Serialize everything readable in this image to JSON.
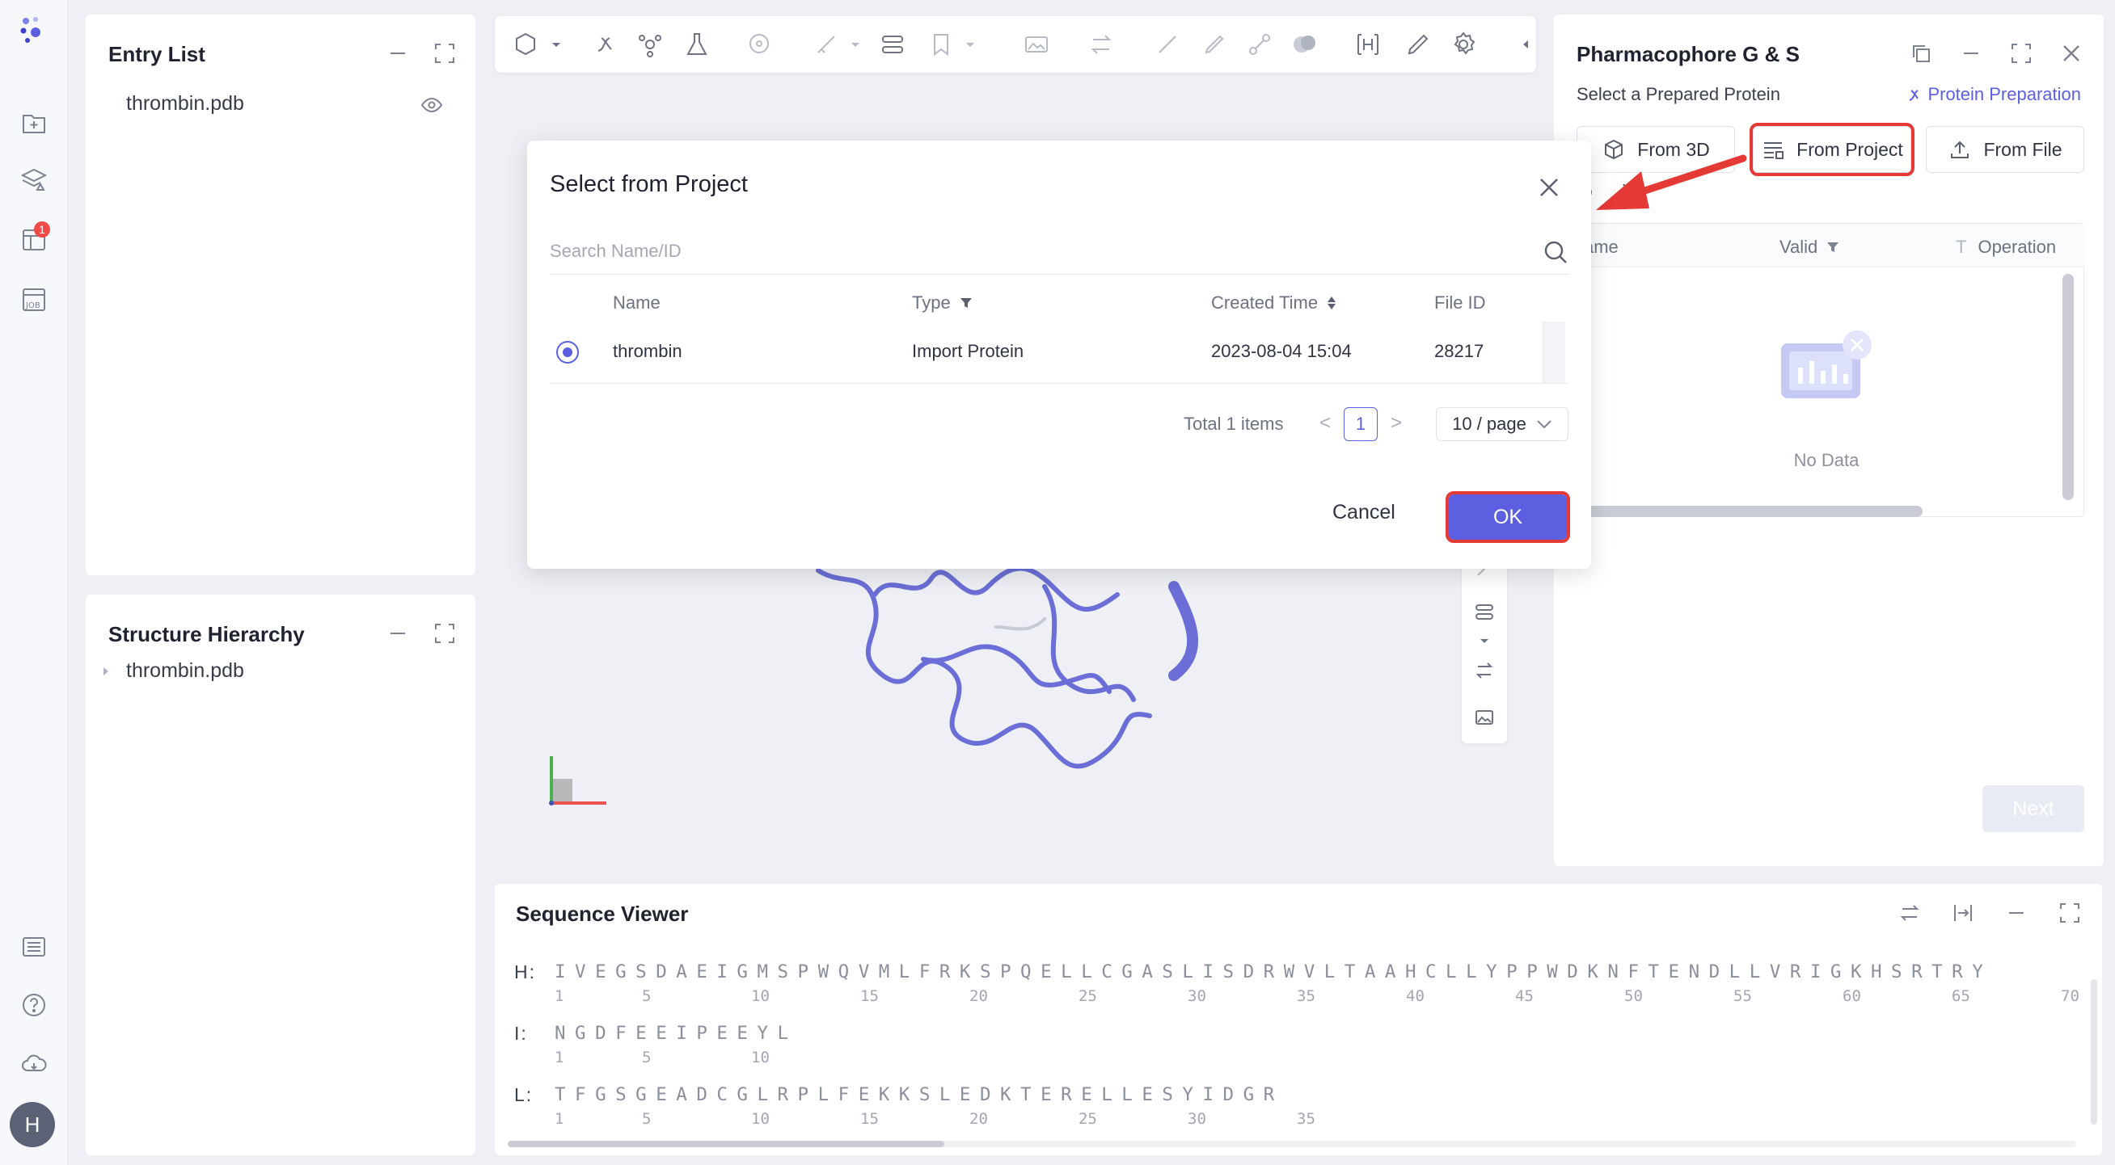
{
  "entry_list": {
    "title": "Entry List",
    "items": [
      {
        "label": "thrombin.pdb"
      }
    ]
  },
  "structure_hierarchy": {
    "title": "Structure Hierarchy",
    "items": [
      {
        "label": "thrombin.pdb"
      }
    ]
  },
  "right_panel": {
    "title": "Pharmacophore G & S",
    "section_label": "Select a Prepared Protein",
    "prep_link": "Protein Preparation",
    "buttons": {
      "from_3d": "From 3D",
      "from_project": "From Project",
      "from_file": "From File"
    },
    "partial_section_label": "ro      ile",
    "table_headers": {
      "name": "ame",
      "valid": "Valid",
      "operation": "Operation"
    },
    "empty_text": "No Data",
    "next_label": "Next"
  },
  "modal": {
    "title": "Select from Project",
    "search_placeholder": "Search Name/ID",
    "columns": {
      "name": "Name",
      "type": "Type",
      "created": "Created Time",
      "file_id": "File ID"
    },
    "rows": [
      {
        "name": "thrombin",
        "type": "Import Protein",
        "created": "2023-08-04 15:04",
        "file_id": "28217",
        "selected": true
      }
    ],
    "pagination": {
      "total": "Total 1 items",
      "current": "1",
      "page_size": "10 / page"
    },
    "cancel_label": "Cancel",
    "ok_label": "OK"
  },
  "sequence_viewer": {
    "title": "Sequence Viewer",
    "chains": [
      {
        "label": "H:",
        "sequence": "IVEGSDAEIGMSPWQVMLFRKSPQELLCGASLISDRWVLTAAHCLLYPPWDKNFTENDLLVRIGKHSRTRY",
        "numbers": [
          "1",
          "5",
          "10",
          "15",
          "20",
          "25",
          "30",
          "35",
          "40",
          "45",
          "50",
          "55",
          "60",
          "65",
          "70"
        ]
      },
      {
        "label": "I:",
        "sequence": "NGDFEEIPEEYL",
        "numbers": [
          "1",
          "5",
          "10"
        ]
      },
      {
        "label": "L:",
        "sequence": "TFGSGEADCGLRPLFEKKSLEDKTERELLESYIDGR",
        "numbers": [
          "1",
          "5",
          "10",
          "15",
          "20",
          "25",
          "30",
          "35"
        ]
      }
    ]
  },
  "colors": {
    "primary": "#5b5fe0",
    "highlight": "#e53935",
    "protein": "#6a6ed6"
  },
  "rail_badge": "1",
  "avatar_initial": "H"
}
